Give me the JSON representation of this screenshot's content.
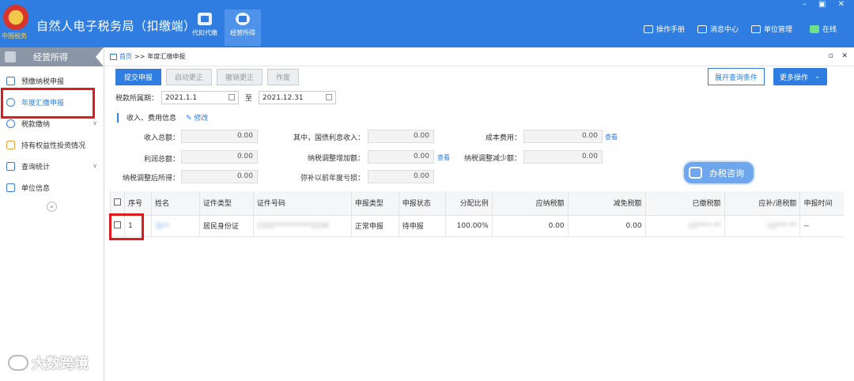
{
  "header": {
    "app_title": "自然人电子税务局（扣缴端）",
    "logo_text": "中国税务",
    "modules": [
      {
        "label": "代扣代缴"
      },
      {
        "label": "经营所得"
      }
    ],
    "nav": [
      {
        "label": "操作手册"
      },
      {
        "label": "消息中心"
      },
      {
        "label": "单位管理"
      },
      {
        "label": "在线"
      }
    ],
    "window_controls": "– ▣ ✕"
  },
  "sidebar": {
    "title": "经营所得",
    "items": [
      {
        "label": "预缴纳税申报"
      },
      {
        "label": "年度汇缴申报"
      },
      {
        "label": "税款缴纳",
        "chevron": "∨"
      },
      {
        "label": "持有权益性投资情况"
      },
      {
        "label": "查询统计",
        "chevron": "∨"
      },
      {
        "label": "单位信息"
      }
    ],
    "collapse": "«"
  },
  "main": {
    "breadcrumb": {
      "home": "首页",
      "sep": ">>",
      "current": "年度汇缴申报",
      "controls": "▫ ✕"
    },
    "toolbar": {
      "submit": "提交申报",
      "start_correction": "启动更正",
      "cancel_correction": "撤销更正",
      "void": "作废",
      "expand_query": "展开查询条件",
      "more": "更多操作"
    },
    "period": {
      "label": "税款所属期：",
      "from": "2021.1.1",
      "to_label": "至",
      "to": "2021.12.31"
    },
    "section": {
      "title": "收入、费用信息",
      "edit": "修改"
    },
    "fields": {
      "income_total": {
        "label": "收入总额：",
        "value": "0.00"
      },
      "interest_income": {
        "label": "其中，国债利息收入：",
        "value": "0.00"
      },
      "cost": {
        "label": "成本费用：",
        "value": "0.00"
      },
      "profit_total": {
        "label": "利润总额：",
        "value": "0.00"
      },
      "adj_increase": {
        "label": "纳税调整增加额：",
        "value": "0.00"
      },
      "adj_decrease": {
        "label": "纳税调整减少额：",
        "value": "0.00"
      },
      "adjusted_income": {
        "label": "纳税调整后所得：",
        "value": "0.00"
      },
      "prior_loss": {
        "label": "弥补以前年度亏损：",
        "value": "0.00"
      },
      "view": "查看"
    },
    "consult": "办税咨询",
    "table": {
      "headers": [
        "序号",
        "姓名",
        "证件类型",
        "证件号码",
        "申报类型",
        "申报状态",
        "分配比例",
        "应纳税额",
        "减免税额",
        "已缴税额",
        "应补/退税额",
        "申报时间"
      ],
      "rows": [
        {
          "seq": "1",
          "name": "马**",
          "id_type": "居民身份证",
          "id_no": "1101**********1234",
          "decl_type": "正常申报",
          "status": "待申报",
          "ratio": "100.00%",
          "tax_due": "0.00",
          "tax_relief": "0.00",
          "tax_paid": "12****.**",
          "tax_refund": "-12***.**",
          "time": "--"
        }
      ]
    }
  },
  "watermark": "大数跨境",
  "colors": {
    "brand_blue": "#2f7de1",
    "highlight_red": "#e01b1b"
  }
}
